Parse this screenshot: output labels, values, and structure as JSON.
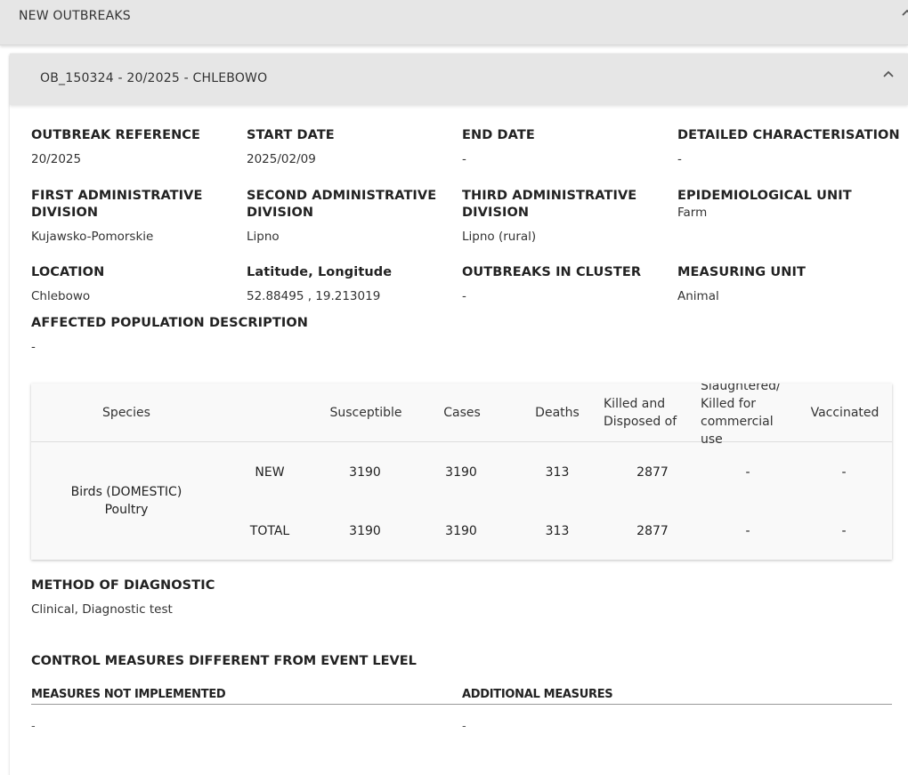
{
  "panel": {
    "title": "NEW OUTBREAKS"
  },
  "outbreak": {
    "header": "OB_150324 - 20/2025 - CHLEBOWO",
    "fields": {
      "outbreak_reference": {
        "label": "OUTBREAK REFERENCE",
        "value": "20/2025"
      },
      "start_date": {
        "label": "START DATE",
        "value": "2025/02/09"
      },
      "end_date": {
        "label": "END DATE",
        "value": "-"
      },
      "detailed_characterisation": {
        "label": "DETAILED CHARACTERISATION",
        "value": "-"
      },
      "first_admin": {
        "label": "FIRST ADMINISTRATIVE DIVISION",
        "value": "Kujawsko-Pomorskie"
      },
      "second_admin": {
        "label": "SECOND ADMINISTRATIVE DIVISION",
        "value": "Lipno"
      },
      "third_admin": {
        "label": "THIRD ADMINISTRATIVE DIVISION",
        "value": "Lipno (rural)"
      },
      "epi_unit": {
        "label": "EPIDEMIOLOGICAL UNIT",
        "value": "Farm"
      },
      "location": {
        "label": "LOCATION",
        "value": "Chlebowo"
      },
      "latlon": {
        "label": "Latitude, Longitude",
        "value": "52.88495 , 19.213019"
      },
      "outbreaks_in_cluster": {
        "label": "OUTBREAKS IN CLUSTER",
        "value": "-"
      },
      "measuring_unit": {
        "label": "MEASURING UNIT",
        "value": "Animal"
      },
      "affected_population": {
        "label": "AFFECTED POPULATION DESCRIPTION",
        "value": "-"
      }
    },
    "table": {
      "headers": {
        "species": "Species",
        "susceptible": "Susceptible",
        "cases": "Cases",
        "deaths": "Deaths",
        "killed": "Killed and Disposed of",
        "slaughtered": "Slaughtered/ Killed for commercial use",
        "vaccinated": "Vaccinated"
      },
      "species": "Birds (DOMESTIC) Poultry",
      "rows": [
        {
          "type": "NEW",
          "susceptible": "3190",
          "cases": "3190",
          "deaths": "313",
          "killed": "2877",
          "slaughtered": "-",
          "vaccinated": "-"
        },
        {
          "type": "TOTAL",
          "susceptible": "3190",
          "cases": "3190",
          "deaths": "313",
          "killed": "2877",
          "slaughtered": "-",
          "vaccinated": "-"
        }
      ]
    },
    "method_of_diagnostic": {
      "label": "METHOD OF DIAGNOSTIC",
      "value": "Clinical, Diagnostic test"
    },
    "control_measures": {
      "title": "CONTROL MEASURES DIFFERENT FROM EVENT LEVEL",
      "not_implemented_label": "MEASURES NOT IMPLEMENTED",
      "not_implemented_value": "-",
      "additional_label": "ADDITIONAL MEASURES",
      "additional_value": "-"
    }
  }
}
